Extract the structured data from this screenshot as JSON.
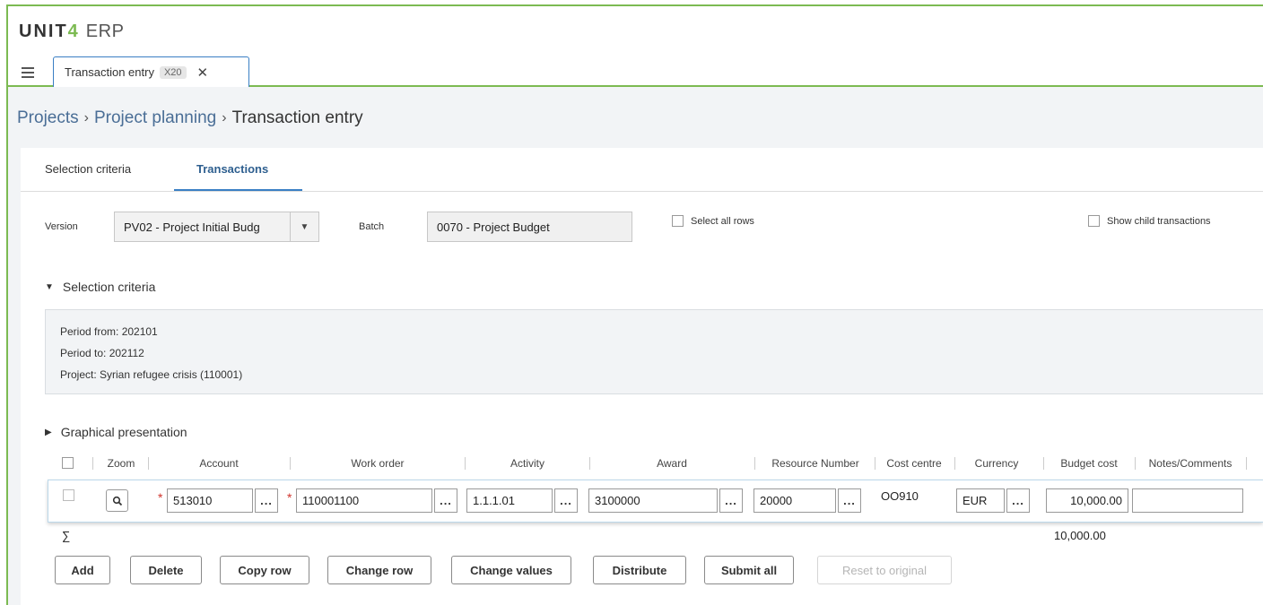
{
  "app": {
    "brand": "UNIT",
    "brand_digit": "4",
    "product": "ERP"
  },
  "doc_tab": {
    "label": "Transaction entry",
    "badge": "X20",
    "close": "✕"
  },
  "breadcrumb": {
    "items": [
      "Projects",
      "Project planning"
    ],
    "separator": "›",
    "current": "Transaction entry"
  },
  "tabs": {
    "selection": "Selection criteria",
    "transactions": "Transactions"
  },
  "filters": {
    "version_label": "Version",
    "version_value": "PV02 - Project Initial Budg",
    "batch_label": "Batch",
    "batch_value": "0070 - Project Budget",
    "select_all_rows": "Select all rows",
    "show_child": "Show child transactions"
  },
  "criteria": {
    "title": "Selection criteria",
    "lines": [
      "Period from: 202101",
      "Period to: 202112",
      "Project: Syrian refugee crisis (110001)"
    ]
  },
  "graphical": {
    "title": "Graphical presentation"
  },
  "grid": {
    "columns": {
      "zoom": "Zoom",
      "account": "Account",
      "work_order": "Work order",
      "activity": "Activity",
      "award": "Award",
      "resource": "Resource Number",
      "cost_centre": "Cost centre",
      "currency": "Currency",
      "budget_cost": "Budget cost",
      "notes": "Notes/Comments"
    },
    "row": {
      "required_mark": "*",
      "account": "513010",
      "work_order": "110001100",
      "activity": "1.1.1.01",
      "award": "3100000",
      "resource": "20000",
      "cost_centre": "OO910",
      "currency": "EUR",
      "budget_cost": "10,000.00",
      "notes": "",
      "lookup": "..."
    },
    "sum_symbol": "∑",
    "sum_budget": "10,000.00"
  },
  "buttons": {
    "add": "Add",
    "delete": "Delete",
    "copy_row": "Copy row",
    "change_row": "Change row",
    "change_values": "Change values",
    "distribute": "Distribute",
    "submit_all": "Submit all",
    "reset": "Reset to original"
  },
  "colors": {
    "brand_green": "#7cba52",
    "link_blue": "#4a6e96",
    "active_tab": "#3a7fc4",
    "required": "#d0342c"
  }
}
